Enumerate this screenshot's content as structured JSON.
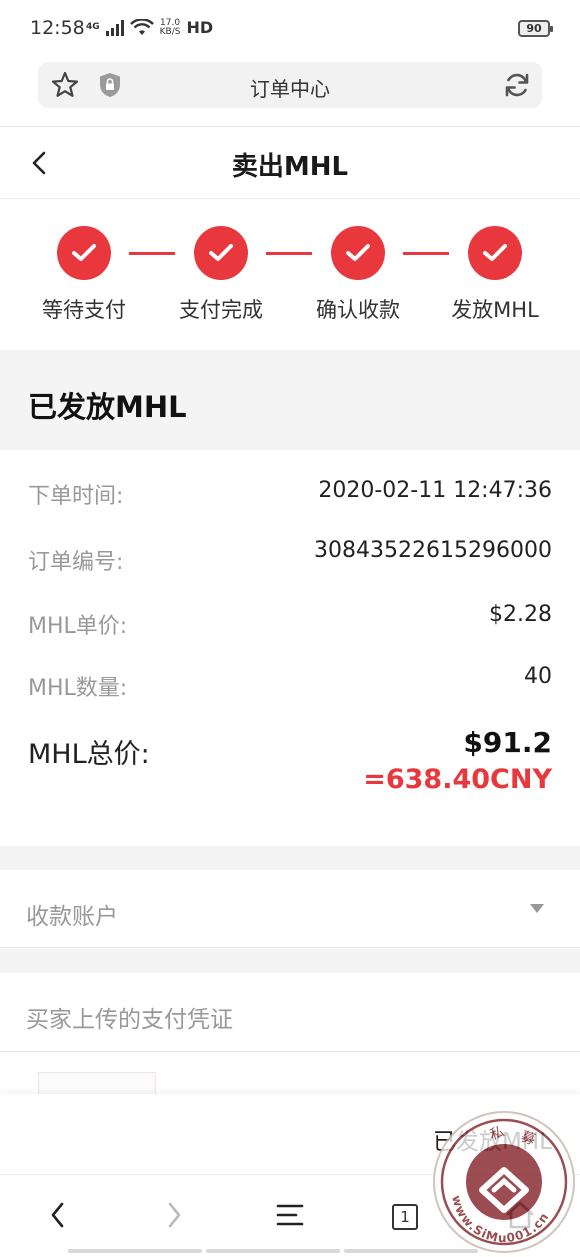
{
  "status_bar": {
    "time": "12:58",
    "network": "4G",
    "speed_value": "17.0",
    "speed_unit": "KB/S",
    "hd": "HD",
    "battery": "90"
  },
  "browser": {
    "title": "订单中心"
  },
  "header": {
    "title": "卖出MHL"
  },
  "steps": [
    {
      "label": "等待支付"
    },
    {
      "label": "支付完成"
    },
    {
      "label": "确认收款"
    },
    {
      "label": "发放MHL"
    }
  ],
  "order": {
    "status": "已发放MHL",
    "details": [
      {
        "label": "下单时间:",
        "value": "2020-02-11 12:47:36"
      },
      {
        "label": "订单编号:",
        "value": "30843522615296000"
      },
      {
        "label": "MHL单价:",
        "value": "$2.28"
      },
      {
        "label": "MHL数量:",
        "value": "40"
      }
    ],
    "total_label": "MHL总价:",
    "total_value": "$91.2",
    "total_cny": "=638.40CNY"
  },
  "account": {
    "label": "收款账户"
  },
  "proof": {
    "label": "买家上传的支付凭证"
  },
  "action_bar": {
    "status": "已发放MHL"
  },
  "watermark": {
    "text": "www.SiMu001.cn",
    "chars": "私募"
  },
  "nav": {
    "tab_count": "1"
  },
  "colors": {
    "accent": "#e8383d",
    "muted_text": "#999999",
    "section_bg": "#f4f4f4"
  }
}
